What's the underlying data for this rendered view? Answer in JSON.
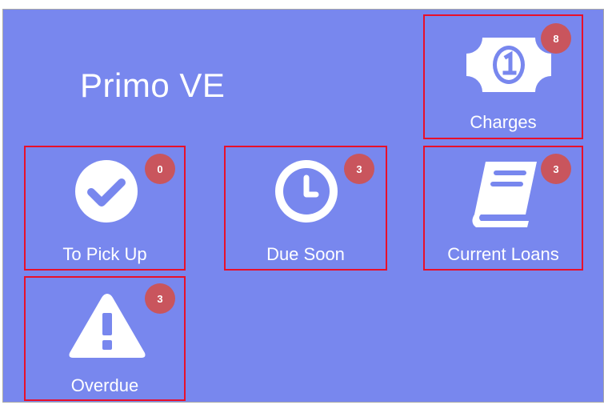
{
  "header": {
    "title": "Primo VE"
  },
  "tiles": {
    "charges": {
      "label": "Charges",
      "count": "8",
      "icon": "money-bill-icon"
    },
    "to_pick_up": {
      "label": "To Pick Up",
      "count": "0",
      "icon": "check-circle-icon"
    },
    "due_soon": {
      "label": "Due Soon",
      "count": "3",
      "icon": "clock-icon"
    },
    "current_loans": {
      "label": "Current Loans",
      "count": "3",
      "icon": "book-icon"
    },
    "overdue": {
      "label": "Overdue",
      "count": "3",
      "icon": "warning-triangle-icon"
    }
  },
  "colors": {
    "background": "#7887ee",
    "highlight_border": "#e8102a",
    "badge": "#c9555d"
  }
}
